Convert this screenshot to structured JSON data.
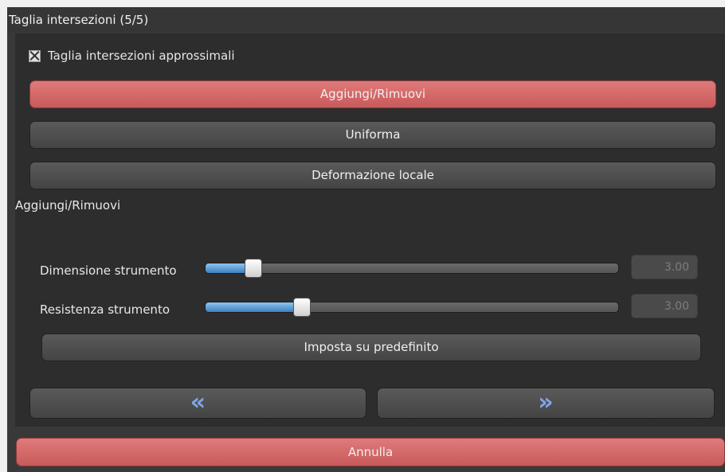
{
  "panel": {
    "title": "Taglia intersezioni (5/5)",
    "checkbox_label": "Taglia intersezioni approssimali",
    "checkbox_checked": true,
    "buttons": {
      "add_remove": "Aggiungi/Rimuovi",
      "smooth": "Uniforma",
      "local_deform": "Deformazione locale"
    },
    "section_label": "Aggiungi/Rimuovi",
    "sliders": [
      {
        "label": "Dimensione strumento",
        "value": "3.00",
        "level": 0.12
      },
      {
        "label": "Resistenza strumento",
        "value": "3.00",
        "level": 0.24
      }
    ],
    "reset_label": "Imposta su predefinito",
    "nav": {
      "prev_icon": "double-chevron-left-icon",
      "next_icon": "double-chevron-right-icon"
    },
    "cancel_label": "Annulla"
  },
  "colors": {
    "accent_red": "#d96b6b",
    "slider_blue": "#4a8ad0",
    "background": "#2d2d2d"
  }
}
